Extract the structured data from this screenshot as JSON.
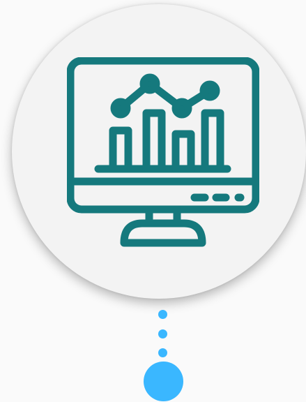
{
  "icon": {
    "name": "analytics-monitor-icon",
    "stroke_color": "#15797d"
  },
  "colors": {
    "background": "#fafafa",
    "circle_fill": "#f3f3f3",
    "accent": "#3ab7ff"
  },
  "connector": {
    "dot_count": 3
  }
}
